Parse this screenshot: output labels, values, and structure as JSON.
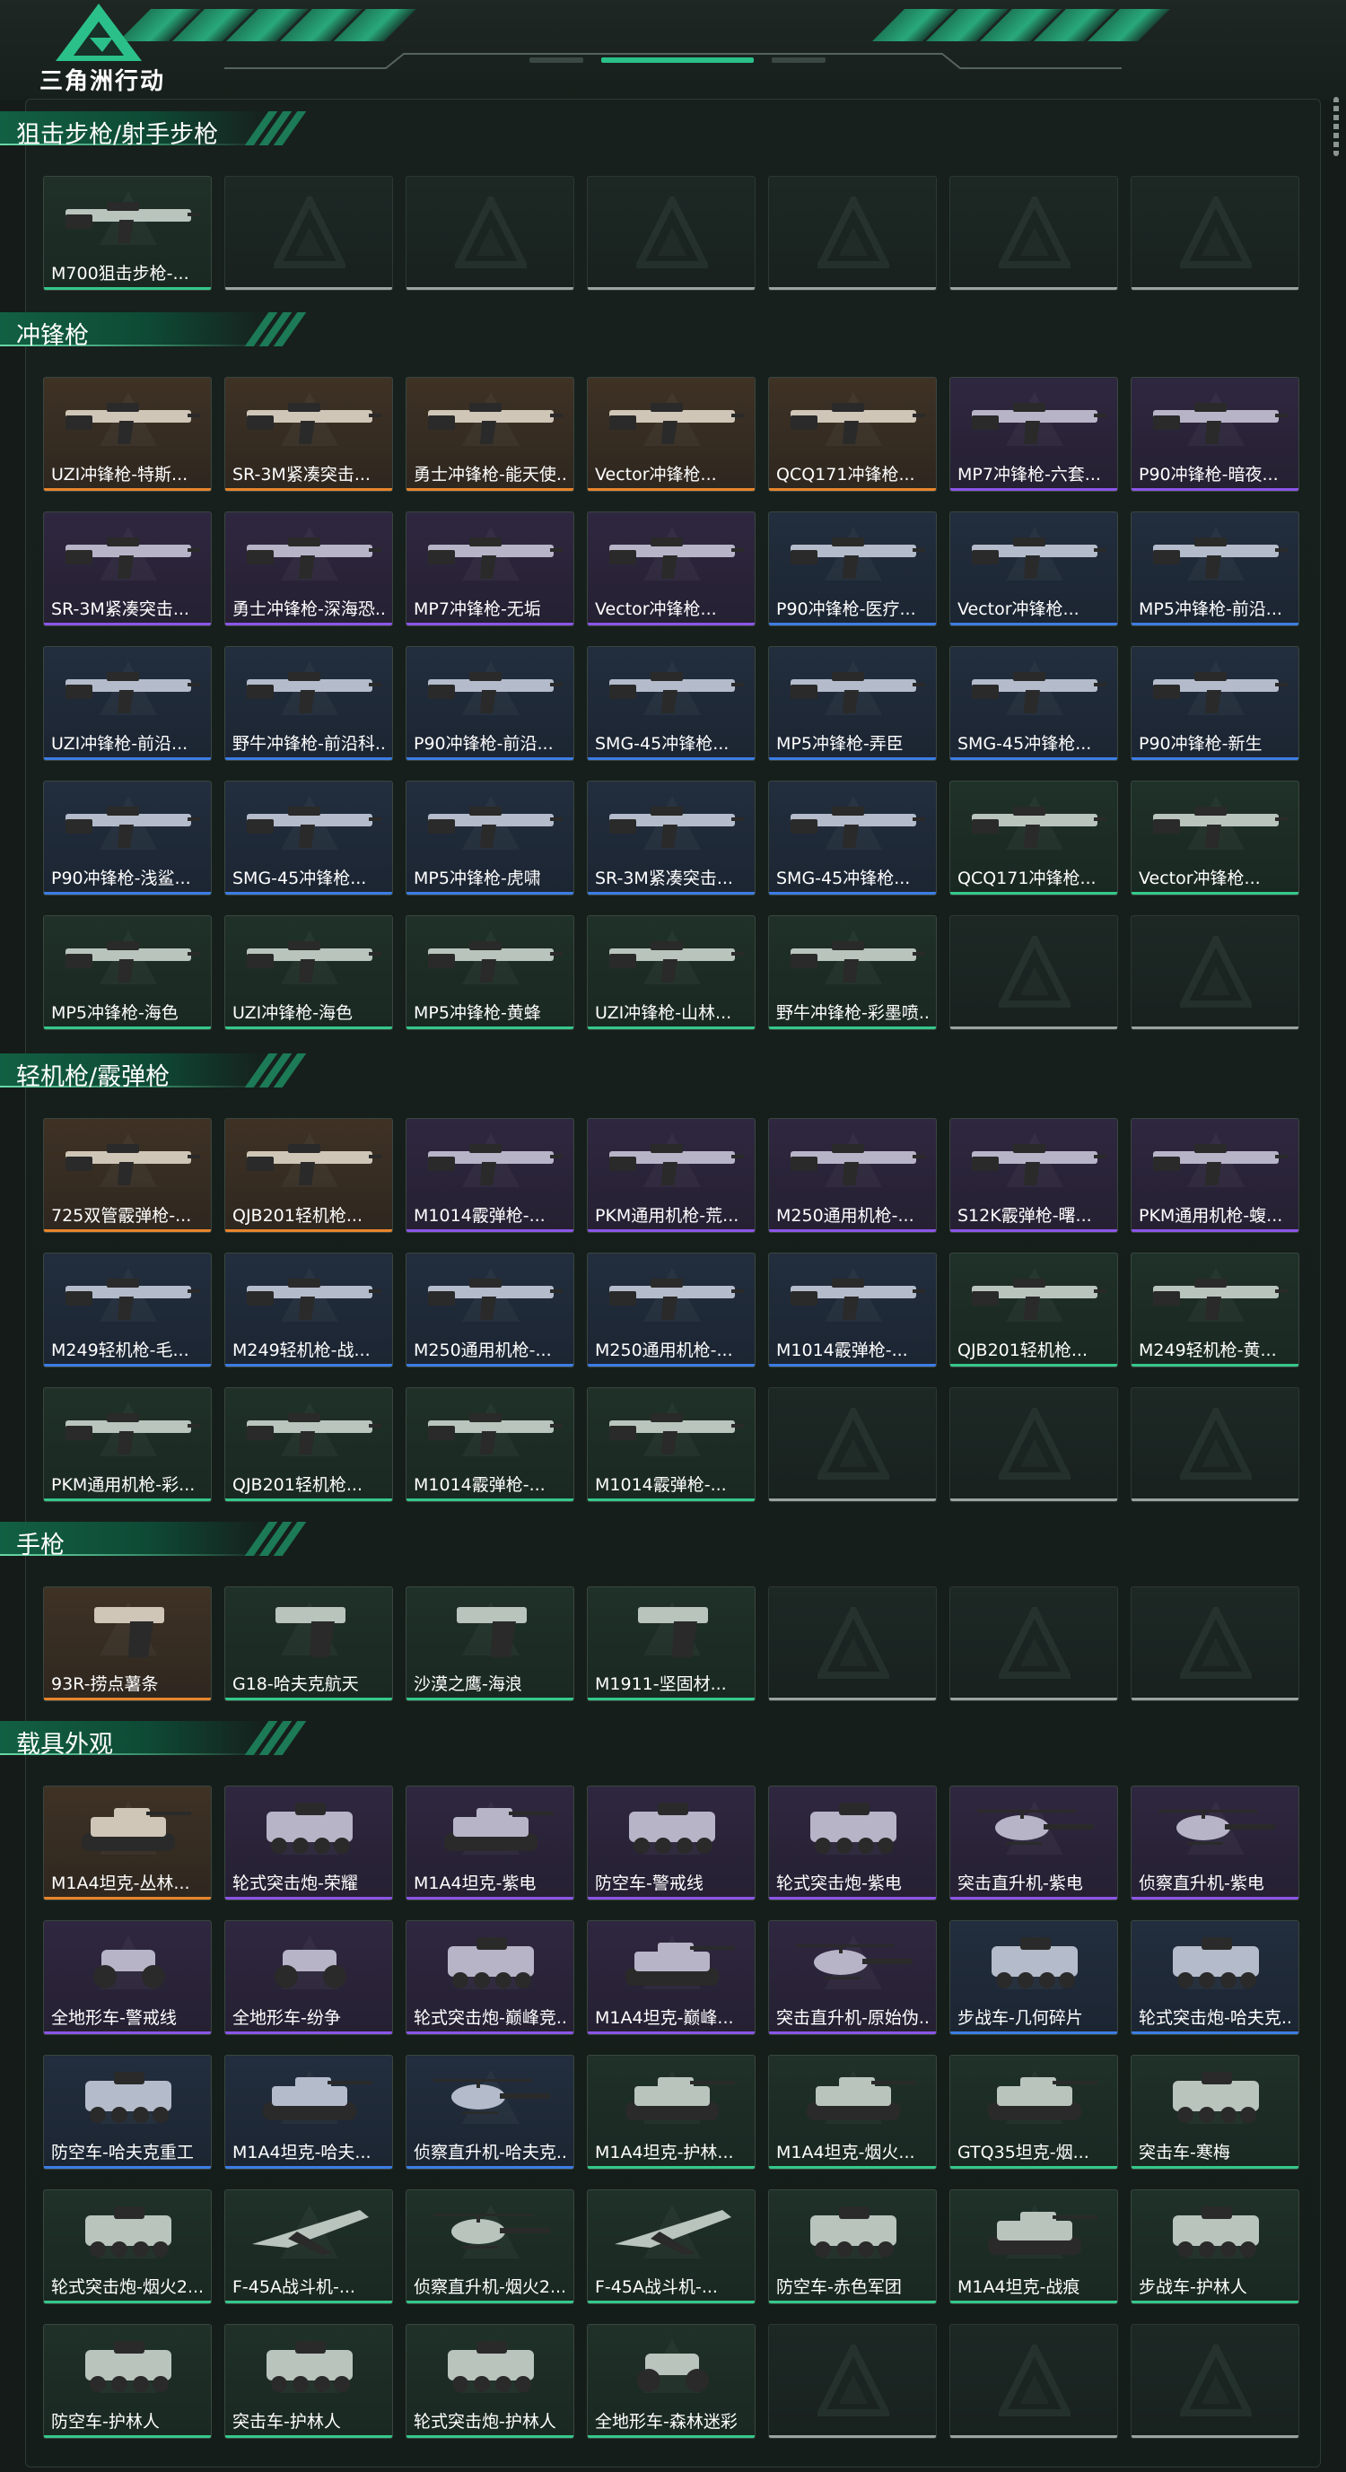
{
  "brand": {
    "logo_text": "三角洲行动"
  },
  "colors": {
    "background": "#141b18",
    "accent": "#2bc08a",
    "rarity_gold": "#e7852c",
    "rarity_purple": "#8c55e8",
    "rarity_blue": "#3d7de3",
    "rarity_green": "#35c88b",
    "empty_slot": "#9aa3a0"
  },
  "sections": [
    {
      "title": "狙击步枪/射手步枪",
      "items": [
        {
          "label": "M700狙击步枪-...",
          "rarity": "green",
          "icon": "sniper-rifle-icon"
        },
        {
          "label": "",
          "rarity": "empty"
        },
        {
          "label": "",
          "rarity": "empty"
        },
        {
          "label": "",
          "rarity": "empty"
        },
        {
          "label": "",
          "rarity": "empty"
        },
        {
          "label": "",
          "rarity": "empty"
        },
        {
          "label": "",
          "rarity": "empty"
        }
      ]
    },
    {
      "title": "冲锋枪",
      "items": [
        {
          "label": "UZI冲锋枪-特斯...",
          "rarity": "gold",
          "icon": "smg-icon"
        },
        {
          "label": "SR-3M紧凑突击...",
          "rarity": "gold",
          "icon": "smg-icon"
        },
        {
          "label": "勇士冲锋枪-能天使...",
          "rarity": "gold",
          "icon": "smg-icon"
        },
        {
          "label": "Vector冲锋枪...",
          "rarity": "gold",
          "icon": "smg-icon"
        },
        {
          "label": "QCQ171冲锋枪...",
          "rarity": "gold",
          "icon": "smg-icon"
        },
        {
          "label": "MP7冲锋枪-六套...",
          "rarity": "purple",
          "icon": "smg-icon"
        },
        {
          "label": "P90冲锋枪-暗夜...",
          "rarity": "purple",
          "icon": "smg-icon"
        },
        {
          "label": "SR-3M紧凑突击...",
          "rarity": "purple",
          "icon": "smg-icon"
        },
        {
          "label": "勇士冲锋枪-深海恐...",
          "rarity": "purple",
          "icon": "smg-icon"
        },
        {
          "label": "MP7冲锋枪-无垢",
          "rarity": "purple",
          "icon": "smg-icon"
        },
        {
          "label": "Vector冲锋枪...",
          "rarity": "purple",
          "icon": "smg-icon"
        },
        {
          "label": "P90冲锋枪-医疗...",
          "rarity": "blue",
          "icon": "smg-icon"
        },
        {
          "label": "Vector冲锋枪...",
          "rarity": "blue",
          "icon": "smg-icon"
        },
        {
          "label": "MP5冲锋枪-前沿...",
          "rarity": "blue",
          "icon": "smg-icon"
        },
        {
          "label": "UZI冲锋枪-前沿...",
          "rarity": "blue",
          "icon": "smg-icon"
        },
        {
          "label": "野牛冲锋枪-前沿科...",
          "rarity": "blue",
          "icon": "smg-icon"
        },
        {
          "label": "P90冲锋枪-前沿...",
          "rarity": "blue",
          "icon": "smg-icon"
        },
        {
          "label": "SMG-45冲锋枪...",
          "rarity": "blue",
          "icon": "smg-icon"
        },
        {
          "label": "MP5冲锋枪-弄臣",
          "rarity": "blue",
          "icon": "smg-icon"
        },
        {
          "label": "SMG-45冲锋枪...",
          "rarity": "blue",
          "icon": "smg-icon"
        },
        {
          "label": "P90冲锋枪-新生",
          "rarity": "blue",
          "icon": "smg-icon"
        },
        {
          "label": "P90冲锋枪-浅鲨...",
          "rarity": "blue",
          "icon": "smg-icon"
        },
        {
          "label": "SMG-45冲锋枪...",
          "rarity": "blue",
          "icon": "smg-icon"
        },
        {
          "label": "MP5冲锋枪-虎啸",
          "rarity": "blue",
          "icon": "smg-icon"
        },
        {
          "label": "SR-3M紧凑突击...",
          "rarity": "blue",
          "icon": "smg-icon"
        },
        {
          "label": "SMG-45冲锋枪...",
          "rarity": "blue",
          "icon": "smg-icon"
        },
        {
          "label": "QCQ171冲锋枪...",
          "rarity": "green",
          "icon": "smg-icon"
        },
        {
          "label": "Vector冲锋枪...",
          "rarity": "green",
          "icon": "smg-icon"
        },
        {
          "label": "MP5冲锋枪-海色",
          "rarity": "green",
          "icon": "smg-icon"
        },
        {
          "label": "UZI冲锋枪-海色",
          "rarity": "green",
          "icon": "smg-icon"
        },
        {
          "label": "MP5冲锋枪-黄蜂",
          "rarity": "green",
          "icon": "smg-icon"
        },
        {
          "label": "UZI冲锋枪-山林...",
          "rarity": "green",
          "icon": "smg-icon"
        },
        {
          "label": "野牛冲锋枪-彩墨喷...",
          "rarity": "green",
          "icon": "smg-icon"
        },
        {
          "label": "",
          "rarity": "empty"
        },
        {
          "label": "",
          "rarity": "empty"
        }
      ]
    },
    {
      "title": "轻机枪/霰弹枪",
      "items": [
        {
          "label": "725双管霰弹枪-...",
          "rarity": "gold",
          "icon": "shotgun-icon"
        },
        {
          "label": "QJB201轻机枪...",
          "rarity": "gold",
          "icon": "lmg-icon"
        },
        {
          "label": "M1014霰弹枪-...",
          "rarity": "purple",
          "icon": "shotgun-icon"
        },
        {
          "label": "PKM通用机枪-荒...",
          "rarity": "purple",
          "icon": "lmg-icon"
        },
        {
          "label": "M250通用机枪-...",
          "rarity": "purple",
          "icon": "lmg-icon"
        },
        {
          "label": "S12K霰弹枪-曙...",
          "rarity": "purple",
          "icon": "shotgun-icon"
        },
        {
          "label": "PKM通用机枪-蝮...",
          "rarity": "purple",
          "icon": "lmg-icon"
        },
        {
          "label": "M249轻机枪-毛...",
          "rarity": "blue",
          "icon": "lmg-icon"
        },
        {
          "label": "M249轻机枪-战...",
          "rarity": "blue",
          "icon": "lmg-icon"
        },
        {
          "label": "M250通用机枪-...",
          "rarity": "blue",
          "icon": "lmg-icon"
        },
        {
          "label": "M250通用机枪-...",
          "rarity": "blue",
          "icon": "lmg-icon"
        },
        {
          "label": "M1014霰弹枪-...",
          "rarity": "blue",
          "icon": "shotgun-icon"
        },
        {
          "label": "QJB201轻机枪...",
          "rarity": "green",
          "icon": "lmg-icon"
        },
        {
          "label": "M249轻机枪-黄...",
          "rarity": "green",
          "icon": "lmg-icon"
        },
        {
          "label": "PKM通用机枪-彩...",
          "rarity": "green",
          "icon": "lmg-icon"
        },
        {
          "label": "QJB201轻机枪...",
          "rarity": "green",
          "icon": "lmg-icon"
        },
        {
          "label": "M1014霰弹枪-...",
          "rarity": "green",
          "icon": "shotgun-icon"
        },
        {
          "label": "M1014霰弹枪-...",
          "rarity": "green",
          "icon": "shotgun-icon"
        },
        {
          "label": "",
          "rarity": "empty"
        },
        {
          "label": "",
          "rarity": "empty"
        },
        {
          "label": "",
          "rarity": "empty"
        }
      ]
    },
    {
      "title": "手枪",
      "items": [
        {
          "label": "93R-捞点薯条",
          "rarity": "gold",
          "icon": "pistol-icon"
        },
        {
          "label": "G18-哈夫克航天",
          "rarity": "green",
          "icon": "pistol-icon"
        },
        {
          "label": "沙漠之鹰-海浪",
          "rarity": "green",
          "icon": "pistol-icon"
        },
        {
          "label": "M1911-坚固材...",
          "rarity": "green",
          "icon": "pistol-icon"
        },
        {
          "label": "",
          "rarity": "empty"
        },
        {
          "label": "",
          "rarity": "empty"
        },
        {
          "label": "",
          "rarity": "empty"
        }
      ]
    },
    {
      "title": "载具外观",
      "items": [
        {
          "label": "M1A4坦克-丛林...",
          "rarity": "gold",
          "icon": "tank-icon"
        },
        {
          "label": "轮式突击炮-荣耀",
          "rarity": "purple",
          "icon": "armored-car-icon"
        },
        {
          "label": "M1A4坦克-紫电",
          "rarity": "purple",
          "icon": "tank-icon"
        },
        {
          "label": "防空车-警戒线",
          "rarity": "purple",
          "icon": "armored-car-icon"
        },
        {
          "label": "轮式突击炮-紫电",
          "rarity": "purple",
          "icon": "armored-car-icon"
        },
        {
          "label": "突击直升机-紫电",
          "rarity": "purple",
          "icon": "helicopter-icon"
        },
        {
          "label": "侦察直升机-紫电",
          "rarity": "purple",
          "icon": "helicopter-icon"
        },
        {
          "label": "全地形车-警戒线",
          "rarity": "purple",
          "icon": "atv-icon"
        },
        {
          "label": "全地形车-纷争",
          "rarity": "purple",
          "icon": "atv-icon"
        },
        {
          "label": "轮式突击炮-巅峰竞...",
          "rarity": "purple",
          "icon": "armored-car-icon"
        },
        {
          "label": "M1A4坦克-巅峰...",
          "rarity": "purple",
          "icon": "tank-icon"
        },
        {
          "label": "突击直升机-原始伪...",
          "rarity": "purple",
          "icon": "helicopter-icon"
        },
        {
          "label": "步战车-几何碎片",
          "rarity": "blue",
          "icon": "armored-car-icon"
        },
        {
          "label": "轮式突击炮-哈夫克...",
          "rarity": "blue",
          "icon": "armored-car-icon"
        },
        {
          "label": "防空车-哈夫克重工",
          "rarity": "blue",
          "icon": "armored-car-icon"
        },
        {
          "label": "M1A4坦克-哈夫...",
          "rarity": "blue",
          "icon": "tank-icon"
        },
        {
          "label": "侦察直升机-哈夫克...",
          "rarity": "blue",
          "icon": "helicopter-icon"
        },
        {
          "label": "M1A4坦克-护林...",
          "rarity": "green",
          "icon": "tank-icon"
        },
        {
          "label": "M1A4坦克-烟火...",
          "rarity": "green",
          "icon": "tank-icon"
        },
        {
          "label": "GTQ35坦克-烟...",
          "rarity": "green",
          "icon": "tank-icon"
        },
        {
          "label": "突击车-寒梅",
          "rarity": "green",
          "icon": "armored-car-icon"
        },
        {
          "label": "轮式突击炮-烟火2...",
          "rarity": "green",
          "icon": "armored-car-icon"
        },
        {
          "label": "F-45A战斗机-...",
          "rarity": "green",
          "icon": "fighter-jet-icon"
        },
        {
          "label": "侦察直升机-烟火2...",
          "rarity": "green",
          "icon": "helicopter-icon"
        },
        {
          "label": "F-45A战斗机-...",
          "rarity": "green",
          "icon": "fighter-jet-icon"
        },
        {
          "label": "防空车-赤色军团",
          "rarity": "green",
          "icon": "armored-car-icon"
        },
        {
          "label": "M1A4坦克-战痕",
          "rarity": "green",
          "icon": "tank-icon"
        },
        {
          "label": "步战车-护林人",
          "rarity": "green",
          "icon": "armored-car-icon"
        },
        {
          "label": "防空车-护林人",
          "rarity": "green",
          "icon": "armored-car-icon"
        },
        {
          "label": "突击车-护林人",
          "rarity": "green",
          "icon": "armored-car-icon"
        },
        {
          "label": "轮式突击炮-护林人",
          "rarity": "green",
          "icon": "armored-car-icon"
        },
        {
          "label": "全地形车-森林迷彩",
          "rarity": "green",
          "icon": "atv-icon"
        },
        {
          "label": "",
          "rarity": "empty"
        },
        {
          "label": "",
          "rarity": "empty"
        },
        {
          "label": "",
          "rarity": "empty"
        }
      ]
    }
  ]
}
